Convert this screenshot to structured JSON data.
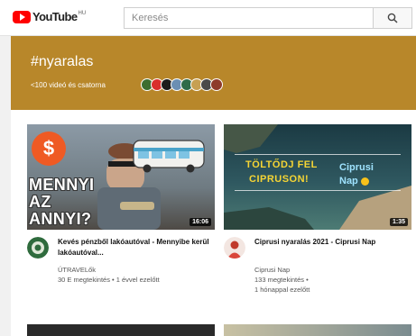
{
  "header": {
    "logo_text": "YouTube",
    "logo_country": "HU",
    "search_placeholder": "Keresés",
    "search_icon": "search-icon"
  },
  "banner": {
    "hashtag": "#nyaralas",
    "subtitle": "<100 videó és csatorna",
    "accent_color": "#b8872a",
    "avatar_colors": [
      "#3c6e2f",
      "#d9302c",
      "#1c1c1c",
      "#6b8fb3",
      "#2e6b49",
      "#c7a052",
      "#4a4a4a",
      "#8e3b2b"
    ]
  },
  "videos": [
    {
      "thumb_text": [
        "MENNYI",
        "AZ",
        "ANNYI?"
      ],
      "thumb_badge": "$",
      "duration": "16:06",
      "title": "Kevés pénzből lakóautóval - Mennyibe kerül lakóautóval...",
      "channel": "ÚTRAVELők",
      "views_age": "30 E megtekintés • 1 évvel ezelőtt",
      "views": "",
      "age": ""
    },
    {
      "thumb_text": [
        "TÖLTŐDJ FEL",
        "CIPRUSON!"
      ],
      "thumb_brand": [
        "Ciprusi",
        "Nap"
      ],
      "duration": "1:35",
      "title": "Ciprusi nyaralás 2021 - Ciprusi Nap",
      "channel": "Ciprusi Nap",
      "views_age": "",
      "views": "133 megtekintés •",
      "age": "1 hónappal ezelőtt"
    }
  ]
}
